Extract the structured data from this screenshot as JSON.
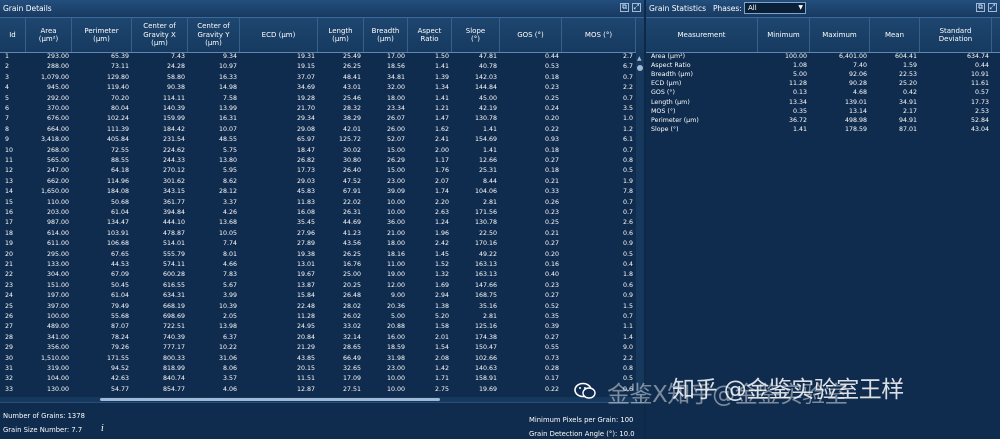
{
  "grain_details": {
    "title": "Grain Details",
    "columns": [
      "Id",
      "Area\n(µm²)",
      "Perimeter\n(µm)",
      "Center of\nGravity X\n(µm)",
      "Center of\nGravity Y\n(µm)",
      "ECD (µm)",
      "Length\n(µm)",
      "Breadth\n(µm)",
      "Aspect\nRatio",
      "Slope\n(°)",
      "GOS (°)",
      "MOS (°)"
    ],
    "rows": [
      [
        "1",
        "293.00",
        "65.39",
        "7.43",
        "9.34",
        "19.31",
        "25.49",
        "17.00",
        "1.50",
        "47.81",
        "0.44",
        "2.7"
      ],
      [
        "2",
        "288.00",
        "73.11",
        "24.28",
        "10.97",
        "19.15",
        "26.25",
        "18.56",
        "1.41",
        "40.78",
        "0.53",
        "6.7"
      ],
      [
        "3",
        "1,079.00",
        "129.80",
        "58.80",
        "16.33",
        "37.07",
        "48.41",
        "34.81",
        "1.39",
        "142.03",
        "0.18",
        "0.7"
      ],
      [
        "4",
        "945.00",
        "119.40",
        "90.38",
        "14.98",
        "34.69",
        "43.01",
        "32.00",
        "1.34",
        "144.84",
        "0.23",
        "2.2"
      ],
      [
        "5",
        "292.00",
        "70.20",
        "114.11",
        "7.58",
        "19.28",
        "25.46",
        "18.00",
        "1.41",
        "45.00",
        "0.25",
        "0.7"
      ],
      [
        "6",
        "370.00",
        "80.04",
        "140.39",
        "13.99",
        "21.70",
        "28.32",
        "23.34",
        "1.21",
        "42.19",
        "0.24",
        "3.5"
      ],
      [
        "7",
        "676.00",
        "102.24",
        "159.99",
        "16.31",
        "29.34",
        "38.29",
        "26.07",
        "1.47",
        "130.78",
        "0.20",
        "1.0"
      ],
      [
        "8",
        "664.00",
        "111.39",
        "184.42",
        "10.07",
        "29.08",
        "42.01",
        "26.00",
        "1.62",
        "1.41",
        "0.22",
        "1.2"
      ],
      [
        "9",
        "3,418.00",
        "405.84",
        "231.54",
        "48.55",
        "65.97",
        "125.72",
        "52.07",
        "2.41",
        "154.69",
        "0.93",
        "6.1"
      ],
      [
        "10",
        "268.00",
        "72.55",
        "224.62",
        "5.75",
        "18.47",
        "30.02",
        "15.00",
        "2.00",
        "1.41",
        "0.18",
        "0.7"
      ],
      [
        "11",
        "565.00",
        "88.55",
        "244.33",
        "13.80",
        "26.82",
        "30.80",
        "26.29",
        "1.17",
        "12.66",
        "0.27",
        "0.8"
      ],
      [
        "12",
        "247.00",
        "64.18",
        "270.12",
        "5.95",
        "17.73",
        "26.40",
        "15.00",
        "1.76",
        "25.31",
        "0.18",
        "0.5"
      ],
      [
        "13",
        "662.00",
        "114.96",
        "301.62",
        "8.62",
        "29.03",
        "47.52",
        "23.00",
        "2.07",
        "8.44",
        "0.21",
        "1.9"
      ],
      [
        "14",
        "1,650.00",
        "184.08",
        "343.15",
        "28.12",
        "45.83",
        "67.91",
        "39.09",
        "1.74",
        "104.06",
        "0.33",
        "7.8"
      ],
      [
        "15",
        "110.00",
        "50.68",
        "361.77",
        "3.37",
        "11.83",
        "22.02",
        "10.00",
        "2.20",
        "2.81",
        "0.26",
        "0.7"
      ],
      [
        "16",
        "203.00",
        "61.04",
        "394.84",
        "4.26",
        "16.08",
        "26.31",
        "10.00",
        "2.63",
        "171.56",
        "0.23",
        "0.7"
      ],
      [
        "17",
        "987.00",
        "134.47",
        "444.10",
        "13.68",
        "35.45",
        "44.69",
        "36.00",
        "1.24",
        "130.78",
        "0.25",
        "2.6"
      ],
      [
        "18",
        "614.00",
        "103.91",
        "478.87",
        "10.05",
        "27.96",
        "41.23",
        "21.00",
        "1.96",
        "22.50",
        "0.21",
        "0.6"
      ],
      [
        "19",
        "611.00",
        "106.68",
        "514.01",
        "7.74",
        "27.89",
        "43.56",
        "18.00",
        "2.42",
        "170.16",
        "0.27",
        "0.9"
      ],
      [
        "20",
        "295.00",
        "67.65",
        "555.79",
        "8.01",
        "19.38",
        "26.25",
        "18.16",
        "1.45",
        "49.22",
        "0.20",
        "0.5"
      ],
      [
        "21",
        "133.00",
        "44.53",
        "574.11",
        "4.66",
        "13.01",
        "16.76",
        "11.00",
        "1.52",
        "163.13",
        "0.16",
        "0.4"
      ],
      [
        "22",
        "304.00",
        "67.09",
        "600.28",
        "7.83",
        "19.67",
        "25.00",
        "19.00",
        "1.32",
        "163.13",
        "0.40",
        "1.8"
      ],
      [
        "23",
        "151.00",
        "50.45",
        "616.55",
        "5.67",
        "13.87",
        "20.25",
        "12.00",
        "1.69",
        "147.66",
        "0.23",
        "0.6"
      ],
      [
        "24",
        "197.00",
        "61.04",
        "634.31",
        "3.99",
        "15.84",
        "26.48",
        "9.00",
        "2.94",
        "168.75",
        "0.27",
        "0.9"
      ],
      [
        "25",
        "397.00",
        "79.49",
        "668.19",
        "10.39",
        "22.48",
        "28.02",
        "20.36",
        "1.38",
        "35.16",
        "0.52",
        "1.5"
      ],
      [
        "26",
        "100.00",
        "55.68",
        "698.69",
        "2.05",
        "11.28",
        "26.02",
        "5.00",
        "5.20",
        "2.81",
        "0.35",
        "0.7"
      ],
      [
        "27",
        "489.00",
        "87.07",
        "722.51",
        "13.98",
        "24.95",
        "33.02",
        "20.88",
        "1.58",
        "125.16",
        "0.39",
        "1.1"
      ],
      [
        "28",
        "341.00",
        "78.24",
        "740.39",
        "6.37",
        "20.84",
        "32.14",
        "16.00",
        "2.01",
        "174.38",
        "0.27",
        "1.4"
      ],
      [
        "29",
        "356.00",
        "79.26",
        "777.17",
        "10.22",
        "21.29",
        "28.65",
        "18.59",
        "1.54",
        "150.47",
        "0.55",
        "9.0"
      ],
      [
        "30",
        "1,510.00",
        "171.55",
        "800.33",
        "31.06",
        "43.85",
        "66.49",
        "31.98",
        "2.08",
        "102.66",
        "0.73",
        "2.2"
      ],
      [
        "31",
        "319.00",
        "94.52",
        "818.99",
        "8.06",
        "20.15",
        "32.65",
        "23.00",
        "1.42",
        "140.63",
        "0.28",
        "0.8"
      ],
      [
        "32",
        "104.00",
        "42.63",
        "840.74",
        "3.57",
        "11.51",
        "17.09",
        "10.00",
        "1.71",
        "158.91",
        "0.17",
        "0.5"
      ],
      [
        "33",
        "130.00",
        "54.77",
        "854.77",
        "4.06",
        "12.87",
        "27.51",
        "10.00",
        "2.75",
        "19.69",
        "0.22",
        "0.6"
      ]
    ],
    "footer": {
      "number_of_grains": "Number of Grains:  1378",
      "grain_size_number": "Grain Size Number:  7.7",
      "min_pixels": "Minimum Pixels per Grain:  100",
      "detection_angle": "Grain Detection Angle (°):  10.0"
    }
  },
  "grain_statistics": {
    "title": "Grain Statistics",
    "phases_label": "Phases:",
    "phases_value": "All",
    "columns": [
      "Measurement",
      "Minimum",
      "Maximum",
      "Mean",
      "Standard\nDeviation"
    ],
    "rows": [
      [
        "Area (µm²)",
        "100.00",
        "6,401.00",
        "604.41",
        "634.74"
      ],
      [
        "Aspect Ratio",
        "1.08",
        "7.40",
        "1.59",
        "0.44"
      ],
      [
        "Breadth (µm)",
        "5.00",
        "92.06",
        "22.53",
        "10.91"
      ],
      [
        "ECD (µm)",
        "11.28",
        "90.28",
        "25.20",
        "11.61"
      ],
      [
        "GOS (°)",
        "0.13",
        "4.68",
        "0.42",
        "0.57"
      ],
      [
        "Length (µm)",
        "13.34",
        "139.01",
        "34.91",
        "17.73"
      ],
      [
        "MOS (°)",
        "0.35",
        "13.14",
        "2.17",
        "2.53"
      ],
      [
        "Perimeter (µm)",
        "36.72",
        "498.98",
        "94.91",
        "52.84"
      ],
      [
        "Slope (°)",
        "1.41",
        "178.59",
        "87.01",
        "43.04"
      ]
    ]
  },
  "watermark": {
    "ghost": "金鉴X知乎@金鉴实验室",
    "main": "知乎 @金鉴实验室王样"
  },
  "icons": {
    "restore": "restore-icon",
    "expand": "expand-icon",
    "info": "info-icon",
    "dropdown_arrow": "chevron-down-icon",
    "wechat": "wechat-icon"
  }
}
